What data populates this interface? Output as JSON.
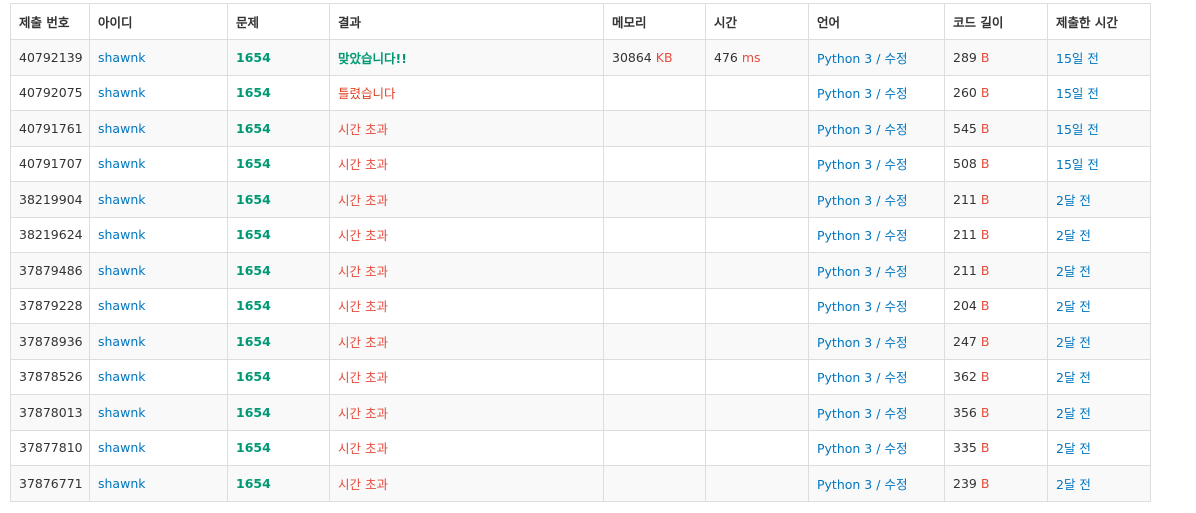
{
  "headers": [
    "제출 번호",
    "아이디",
    "문제",
    "결과",
    "메모리",
    "시간",
    "언어",
    "코드 길이",
    "제출한 시간"
  ],
  "units": {
    "memory": "KB",
    "time": "ms",
    "code": "B"
  },
  "colors": {
    "link": "#0076c0",
    "accepted": "#009874",
    "wrong": "#dd4124"
  },
  "rows": [
    {
      "id": "40792139",
      "user": "shawnk",
      "problem": "1654",
      "result": "맞았습니다!!",
      "status": "ac",
      "memory": "30864",
      "time": "476",
      "lang": "Python 3",
      "edit": "수정",
      "code": "289",
      "submitted": "15일 전"
    },
    {
      "id": "40792075",
      "user": "shawnk",
      "problem": "1654",
      "result": "틀렸습니다",
      "status": "wa",
      "memory": "",
      "time": "",
      "lang": "Python 3",
      "edit": "수정",
      "code": "260",
      "submitted": "15일 전"
    },
    {
      "id": "40791761",
      "user": "shawnk",
      "problem": "1654",
      "result": "시간 초과",
      "status": "tle",
      "memory": "",
      "time": "",
      "lang": "Python 3",
      "edit": "수정",
      "code": "545",
      "submitted": "15일 전"
    },
    {
      "id": "40791707",
      "user": "shawnk",
      "problem": "1654",
      "result": "시간 초과",
      "status": "tle",
      "memory": "",
      "time": "",
      "lang": "Python 3",
      "edit": "수정",
      "code": "508",
      "submitted": "15일 전"
    },
    {
      "id": "38219904",
      "user": "shawnk",
      "problem": "1654",
      "result": "시간 초과",
      "status": "tle",
      "memory": "",
      "time": "",
      "lang": "Python 3",
      "edit": "수정",
      "code": "211",
      "submitted": "2달 전"
    },
    {
      "id": "38219624",
      "user": "shawnk",
      "problem": "1654",
      "result": "시간 초과",
      "status": "tle",
      "memory": "",
      "time": "",
      "lang": "Python 3",
      "edit": "수정",
      "code": "211",
      "submitted": "2달 전"
    },
    {
      "id": "37879486",
      "user": "shawnk",
      "problem": "1654",
      "result": "시간 초과",
      "status": "tle",
      "memory": "",
      "time": "",
      "lang": "Python 3",
      "edit": "수정",
      "code": "211",
      "submitted": "2달 전"
    },
    {
      "id": "37879228",
      "user": "shawnk",
      "problem": "1654",
      "result": "시간 초과",
      "status": "tle",
      "memory": "",
      "time": "",
      "lang": "Python 3",
      "edit": "수정",
      "code": "204",
      "submitted": "2달 전"
    },
    {
      "id": "37878936",
      "user": "shawnk",
      "problem": "1654",
      "result": "시간 초과",
      "status": "tle",
      "memory": "",
      "time": "",
      "lang": "Python 3",
      "edit": "수정",
      "code": "247",
      "submitted": "2달 전"
    },
    {
      "id": "37878526",
      "user": "shawnk",
      "problem": "1654",
      "result": "시간 초과",
      "status": "tle",
      "memory": "",
      "time": "",
      "lang": "Python 3",
      "edit": "수정",
      "code": "362",
      "submitted": "2달 전"
    },
    {
      "id": "37878013",
      "user": "shawnk",
      "problem": "1654",
      "result": "시간 초과",
      "status": "tle",
      "memory": "",
      "time": "",
      "lang": "Python 3",
      "edit": "수정",
      "code": "356",
      "submitted": "2달 전"
    },
    {
      "id": "37877810",
      "user": "shawnk",
      "problem": "1654",
      "result": "시간 초과",
      "status": "tle",
      "memory": "",
      "time": "",
      "lang": "Python 3",
      "edit": "수정",
      "code": "335",
      "submitted": "2달 전"
    },
    {
      "id": "37876771",
      "user": "shawnk",
      "problem": "1654",
      "result": "시간 초과",
      "status": "tle",
      "memory": "",
      "time": "",
      "lang": "Python 3",
      "edit": "수정",
      "code": "239",
      "submitted": "2달 전"
    }
  ]
}
